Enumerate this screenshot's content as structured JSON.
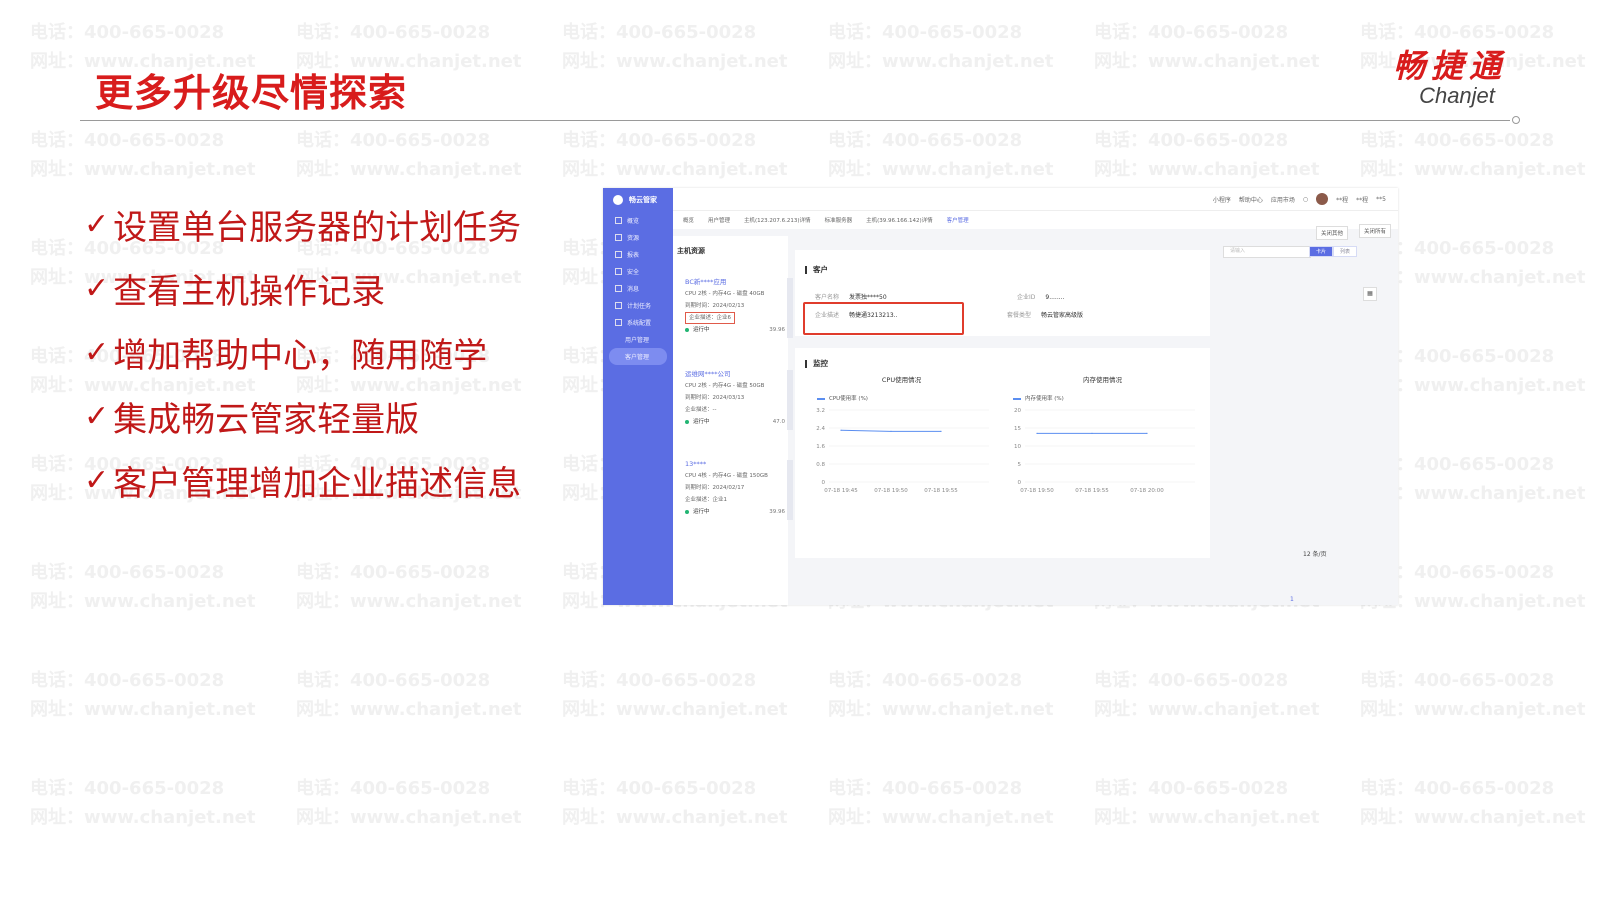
{
  "watermark": {
    "phone": "电话：400-665-0028",
    "site": "网址：www.chanjet.net"
  },
  "slide": {
    "title": "更多升级尽情探索",
    "logo_cn": "畅捷通",
    "logo_en": "Chanjet"
  },
  "bullets": [
    {
      "check": "✓",
      "text": "设置单台服务器的计划任务"
    },
    {
      "check": "✓",
      "text": "查看主机操作记录"
    },
    {
      "check": "✓",
      "text": "增加帮助中心，随用随学"
    },
    {
      "check": "✓",
      "text": "集成畅云管家轻量版"
    },
    {
      "check": "✓",
      "text": "客户管理增加企业描述信息"
    }
  ],
  "app": {
    "brand": "畅云管家",
    "menu": [
      "概览",
      "资源",
      "报表",
      "安全",
      "消息",
      "计划任务",
      "系统配置"
    ],
    "submenu": [
      "用户管理",
      "客户管理"
    ],
    "topbar": [
      "小程序",
      "帮助中心",
      "应用市场",
      "**程",
      "**程",
      "**5"
    ],
    "tabs": [
      "概览",
      "用户管理",
      "主机(123.207.6.213)详情",
      "标准服务器",
      "主机(39.96.166.142)详情",
      "客户管理"
    ],
    "close_others": "关闭其他",
    "close_all": "关闭所有",
    "search_placeholder": "请输入",
    "view_toggle": [
      "卡片",
      "列表"
    ],
    "host_panel_title": "主机资源",
    "hosts": [
      {
        "name": "BC新****应用",
        "spec": "CPU 2核 - 内存4G - 磁盘 40GB",
        "expire": "到期时间：2024/02/13",
        "desc": "企业描述：企业6",
        "status": "运行中",
        "pct": "39.96"
      },
      {
        "name": "运维网****公司",
        "spec": "CPU 2核 - 内存4G - 磁盘 50GB",
        "expire": "到期时间：2024/03/13",
        "desc": "企业描述：--",
        "status": "运行中",
        "pct": "47.0"
      },
      {
        "name": "13****",
        "spec": "CPU 4核 - 内存4G - 磁盘 150GB",
        "expire": "到期时间：2024/02/17",
        "desc": "企业描述：企业1",
        "status": "运行中",
        "pct": "39.96"
      }
    ],
    "customer": {
      "section": "客户",
      "name_label": "客户名称",
      "name_value": "发票独****50",
      "id_label": "企业ID",
      "id_value": "9........",
      "desc_label": "企业描述",
      "desc_value": "畅捷通3213213..",
      "plan_label": "套餐类型",
      "plan_value": "畅云管家高级版"
    },
    "monitor": {
      "section": "监控",
      "page_size": "12 条/页",
      "page_num": "1"
    }
  },
  "chart_data": [
    {
      "type": "line",
      "title": "CPU使用情况",
      "series": [
        {
          "name": "CPU使用率 (%)",
          "x": [
            "07-18 19:45",
            "07-18 19:50",
            "07-18 19:55"
          ],
          "values": [
            2.3,
            2.25,
            2.25
          ]
        }
      ],
      "yticks": [
        "3.2",
        "2.4",
        "1.6",
        "0.8",
        "0"
      ],
      "ylim": [
        0,
        3.2
      ],
      "xlabels": [
        "07-18 19:45",
        "07-18 19:50",
        "07-18 19:55"
      ],
      "grid": true
    },
    {
      "type": "line",
      "title": "内存使用情况",
      "series": [
        {
          "name": "内存使用率 (%)",
          "x": [
            "07-18 19:50",
            "07-18 19:55",
            "07-18 20:00"
          ],
          "values": [
            13.5,
            13.5,
            13.5
          ]
        }
      ],
      "yticks": [
        "20",
        "15",
        "10",
        "5",
        "0"
      ],
      "ylim": [
        0,
        20
      ],
      "xlabels": [
        "07-18 19:50",
        "07-18 19:55",
        "07-18 20:00"
      ],
      "grid": true
    }
  ]
}
